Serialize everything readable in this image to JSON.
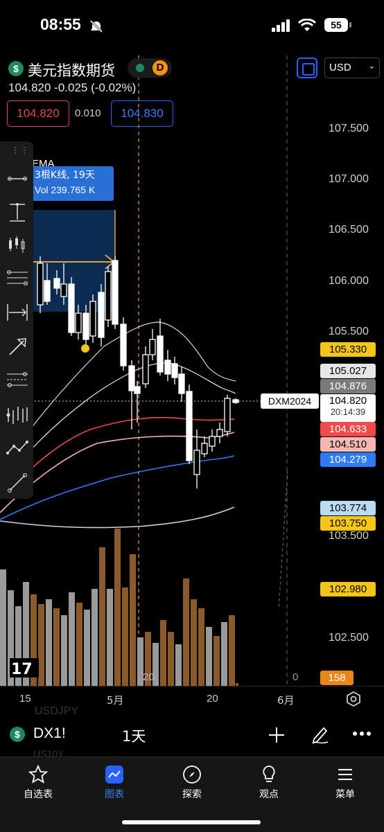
{
  "status": {
    "time": "08:55",
    "battery": "55"
  },
  "header": {
    "symbol_name": "美元指数期货",
    "badge_d": "D",
    "price_line": "104.820  -0.025 (-0.02%)",
    "bid": "104.820",
    "spread": "0.010",
    "ask": "104.830",
    "currency": "USD",
    "accent_color": "#2962ff"
  },
  "info_panel": {
    "line1": "EMA",
    "line2": "3根K线, 19天",
    "line3": "Vol 239.765 K"
  },
  "price_axis": [
    "107.500",
    "107.000",
    "106.500",
    "106.000",
    "105.500",
    "103.500",
    "102.500"
  ],
  "price_tags": [
    {
      "value": "105.330",
      "bg": "#f5c518",
      "color": "#000"
    },
    {
      "value": "105.027",
      "bg": "#e6e6e6",
      "color": "#000"
    },
    {
      "value": "104.876",
      "bg": "#7a7a7a",
      "color": "#fff"
    },
    {
      "value": "104.633",
      "bg": "#f04a4a",
      "color": "#fff"
    },
    {
      "value": "104.510",
      "bg": "#f6b7b0",
      "color": "#000"
    },
    {
      "value": "104.279",
      "bg": "#2f7bf5",
      "color": "#fff"
    },
    {
      "value": "103.774",
      "bg": "#b9dcf5",
      "color": "#000"
    },
    {
      "value": "103.750",
      "bg": "#f5c518",
      "color": "#000"
    },
    {
      "value": "102.980",
      "bg": "#f5c518",
      "color": "#000"
    },
    {
      "value": "158",
      "bg": "#e8861a",
      "color": "#fff"
    }
  ],
  "current": {
    "label": "DXM2024",
    "price": "104.820",
    "countdown": "20:14:39"
  },
  "time_axis": [
    "15",
    "5月",
    "20",
    "6月"
  ],
  "chart_extra_labels": {
    "date_marker": "20",
    "zero": "0"
  },
  "toolbar": {
    "symbol": "DX1!",
    "interval": "1天"
  },
  "ghost_lines": [
    "USDJPY",
    "US10Y"
  ],
  "tabs": [
    {
      "label": "自选表",
      "icon": "star-icon"
    },
    {
      "label": "图表",
      "icon": "chart-icon",
      "active": true
    },
    {
      "label": "探索",
      "icon": "compass-icon"
    },
    {
      "label": "观点",
      "icon": "lightbulb-icon"
    },
    {
      "label": "菜单",
      "icon": "menu-icon"
    }
  ]
}
